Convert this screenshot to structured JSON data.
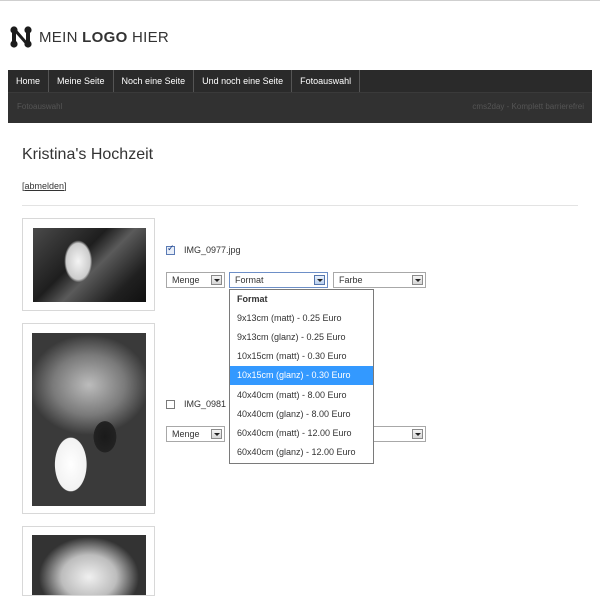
{
  "logo": {
    "text_light": "MEIN ",
    "text_bold": "LOGO",
    "text_end": " HIER"
  },
  "nav": {
    "items": [
      "Home",
      "Meine Seite",
      "Noch eine Seite",
      "Und noch eine Seite",
      "Fotoauswahl"
    ],
    "breadcrumb": "Fotoauswahl",
    "tagline": "cms2day - Komplett barrierefrei"
  },
  "page": {
    "title": "Kristina's Hochzeit",
    "logout_open": "[",
    "logout_label": "abmelden",
    "logout_close": "]"
  },
  "photos": [
    {
      "filename": "IMG_0977.jpg",
      "checked": true,
      "menge_label": "Menge",
      "format_label": "Format",
      "farbe_label": "Farbe"
    },
    {
      "filename": "IMG_0981",
      "checked": false,
      "menge_label": "Menge"
    }
  ],
  "format_dropdown": {
    "header": "Format",
    "options": [
      "9x13cm (matt) - 0.25 Euro",
      "9x13cm (glanz) - 0.25 Euro",
      "10x15cm (matt) - 0.30 Euro",
      "10x15cm (glanz) - 0.30 Euro",
      "40x40cm (matt) - 8.00 Euro",
      "40x40cm (glanz) - 8.00 Euro",
      "60x40cm (matt) - 12.00 Euro",
      "60x40cm (glanz) - 12.00 Euro"
    ],
    "selected_index": 3,
    "highlight_color": "#3399ff"
  },
  "colors": {
    "nav_bg": "#2a2a2a",
    "nav_text": "#ffffff"
  }
}
